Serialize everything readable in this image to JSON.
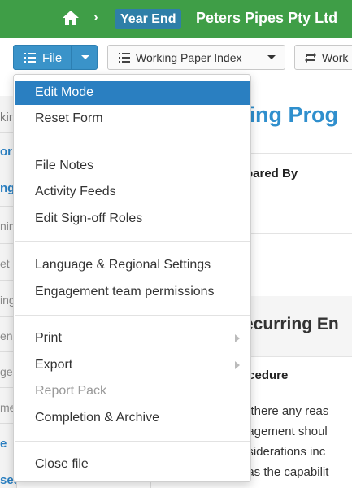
{
  "header": {
    "breadcrumb_sep": "›",
    "period_badge": "Year End",
    "company": "Peters Pipes Pty Ltd"
  },
  "toolbar": {
    "file_label": "File",
    "working_paper_label": "Working Paper Index",
    "work_label": "Work"
  },
  "sidebar": {
    "fragments": [
      "kin",
      "or",
      "ng",
      "nin",
      "et",
      "ing",
      "enc",
      "ge",
      "me",
      "e",
      "ses"
    ]
  },
  "main": {
    "heading": "ning Prog",
    "prepared_by": "pared By",
    "section_title": "ecurring En",
    "column_header": "ocedure",
    "body_lines": [
      "e there any reas",
      "gagement shoul",
      "nsiderations inc",
      "has the capabilit"
    ]
  },
  "file_menu": {
    "items": [
      {
        "label": "Edit Mode",
        "state": "active"
      },
      {
        "label": "Reset Form"
      },
      {
        "label": "File Notes"
      },
      {
        "label": "Activity Feeds"
      },
      {
        "label": "Edit Sign-off Roles"
      },
      {
        "label": "Language & Regional Settings"
      },
      {
        "label": "Engagement team permissions"
      },
      {
        "label": "Print",
        "submenu": true
      },
      {
        "label": "Export",
        "submenu": true
      },
      {
        "label": "Report Pack",
        "state": "disabled"
      },
      {
        "label": "Completion & Archive"
      },
      {
        "label": "Close file"
      }
    ]
  },
  "colors": {
    "header_green": "#3f9e47",
    "badge_blue": "#2f7fa8",
    "primary_blue": "#3a93c9",
    "menu_active": "#2a7fc1",
    "link_blue": "#2f8fcd"
  },
  "icons": {
    "home": "home-icon",
    "file": "list-icon",
    "working_paper": "list-icon",
    "work": "refresh-icon"
  }
}
